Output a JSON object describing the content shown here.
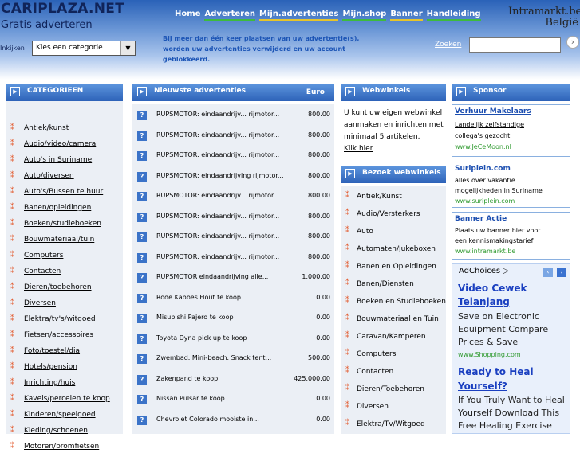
{
  "site": {
    "logo": "CARIPLAZA.NET",
    "tagline": "Gratis adverteren",
    "brand_line1": "Intramarkt.be",
    "brand_line2": "België"
  },
  "topnav": [
    "Home",
    "Adverteren",
    "Mijn.advertenties",
    "Mijn.shop",
    "Banner",
    "Handleiding"
  ],
  "browse": {
    "label": "Inkijken",
    "select_value": "Kies een categorie"
  },
  "notice": "Bij meer dan één keer plaatsen van uw advertentie(s), worden uw advertenties verwijderd en uw account geblokkeerd.",
  "search": {
    "link": "Zoeken",
    "value": ""
  },
  "categories": {
    "title": "CATEGORIEEN",
    "items": [
      "Antiek/kunst",
      "Audio/video/camera",
      "Auto's in Suriname",
      "Auto/diversen",
      "Auto's/Bussen te huur",
      "Banen/opleidingen",
      "Boeken/studieboeken",
      "Bouwmateriaal/tuin",
      "Computers",
      "Contacten",
      "Dieren/toebehoren",
      "Diversen",
      "Elektra/tv's/witgoed",
      "Fietsen/accessoires",
      "Foto/toestel/dia",
      "Hotels/pension",
      "Inrichting/huis",
      "Kavels/percelen te koop",
      "Kinderen/speelgoed",
      "Kleding/schoenen",
      "Motoren/bromfietsen"
    ]
  },
  "newest": {
    "title": "Nieuwste advertenties",
    "currency": "Euro",
    "rows": [
      {
        "title": "RUPSMOTOR: eindaandrijv... rijmotor...",
        "price": "800.00"
      },
      {
        "title": "RUPSMOTOR: eindaandrijv... rijmotor...",
        "price": "800.00"
      },
      {
        "title": "RUPSMOTOR: eindaandrijv... rijmotor...",
        "price": "800.00"
      },
      {
        "title": "RUPSMOTOR: eindaandrijving rijmotor...",
        "price": "800.00"
      },
      {
        "title": "RUPSMOTOR: eindaandrijv... rijmotor...",
        "price": "800.00"
      },
      {
        "title": "RUPSMOTOR: eindaandrijv... rijmotor...",
        "price": "800.00"
      },
      {
        "title": "RUPSMOTOR: eindaandrijv... rijmotor...",
        "price": "800.00"
      },
      {
        "title": "RUPSMOTOR: eindaandrijv... rijmotor...",
        "price": "800.00"
      },
      {
        "title": "RUPSMOTOR eindaandrijving alle...",
        "price": "1.000.00"
      },
      {
        "title": "Rode Kabbes Hout te koop",
        "price": "0.00"
      },
      {
        "title": "Misubishi Pajero te koop",
        "price": "0.00"
      },
      {
        "title": "Toyota Dyna pick up te koop",
        "price": "0.00"
      },
      {
        "title": "Zwembad. Mini-beach. Snack tent...",
        "price": "500.00"
      },
      {
        "title": "Zakenpand te koop",
        "price": "425.000.00"
      },
      {
        "title": "Nissan Pulsar te koop",
        "price": "0.00"
      },
      {
        "title": "Chevrolet Colorado mooiste in...",
        "price": "0.00"
      }
    ]
  },
  "webwinkels": {
    "title": "Webwinkels",
    "text": "U kunt uw eigen webwinkel aanmaken en inrichten met minimaal 5 artikelen.",
    "link": "Klik hier"
  },
  "visit_shops": {
    "title": "Bezoek webwinkels",
    "items": [
      "Antiek/Kunst",
      "Audio/Versterkers",
      "Auto",
      "Automaten/Jukeboxen",
      "Banen en Opleidingen",
      "Banen/Diensten",
      "Boeken en Studieboeken",
      "Bouwmateriaal en Tuin",
      "Caravan/Kamperen",
      "Computers",
      "Contacten",
      "Dieren/Toebehoren",
      "Diversen",
      "Elektra/Tv/Witgoed"
    ]
  },
  "sponsor": {
    "title": "Sponsor",
    "items": [
      {
        "title": "Verhuur Makelaars",
        "lines": [
          "Landelijk zelfstandige",
          "collega's gezocht"
        ],
        "url": "www.JeCeMoon.nl"
      },
      {
        "title": "Suriplein.com",
        "lines": [
          "alles over vakantie",
          "mogelijkheden in Suriname"
        ],
        "url": "www.suriplein.com"
      },
      {
        "title": "Banner Actie",
        "lines": [
          "Plaats uw banner hier voor",
          "een kennismakingstarief"
        ],
        "url": "www.intramarkt.be"
      }
    ]
  },
  "ads": {
    "label": "AdChoices ▷",
    "ad1_title_1": "Video Cewek",
    "ad1_title_2": "Telanjang",
    "ad1_lines": [
      "Save on Electronic",
      "Equipment Compare",
      "Prices & Save"
    ],
    "ad1_url": "www.Shopping.com",
    "ad2_title_1": "Ready to Heal",
    "ad2_title_2": "Yourself?",
    "ad2_lines": [
      "If You Truly Want to Heal",
      "Yourself Download This",
      "Free Healing Exercise"
    ]
  },
  "colors": {
    "header_blue": "#2a62b8",
    "panel_blue": "#2d62b8",
    "bullet_orange": "#e3572a",
    "link_green": "#2f9a2f"
  }
}
